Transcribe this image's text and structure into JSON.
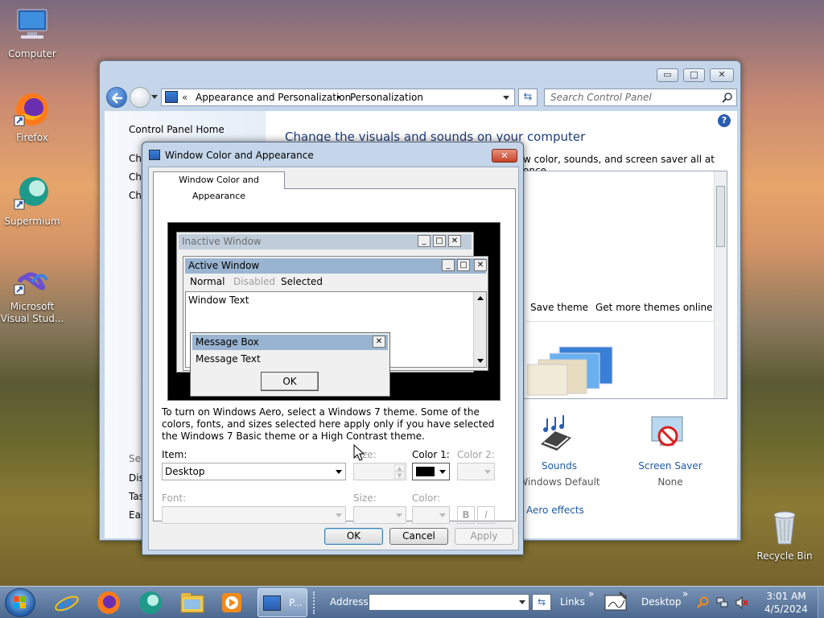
{
  "desktop": {
    "icons": [
      {
        "label": "Computer"
      },
      {
        "label": "Firefox"
      },
      {
        "label": "Supermium"
      },
      {
        "label": "Microsoft Visual Stud..."
      },
      {
        "label": "Recycle Bin"
      }
    ]
  },
  "control_panel": {
    "breadcrumb_prefix": "«",
    "breadcrumb_1": "Appearance and Personalization",
    "breadcrumb_sep": "▸",
    "breadcrumb_2": "Personalization",
    "search_placeholder": "Search Control Panel",
    "left_home": "Control Panel Home",
    "left_links": [
      "Ch",
      "Ch",
      "Ch"
    ],
    "see_also": "See",
    "see_also_links": [
      "Dis",
      "Tas",
      "Eas"
    ],
    "heading": "Change the visuals and sounds on your computer",
    "subheading": "w color, sounds, and screen saver all at once.",
    "save_theme": "Save theme",
    "get_more_themes": "Get more themes online",
    "sounds_label": "Sounds",
    "sounds_value": "Windows Default",
    "screensaver_label": "Screen Saver",
    "screensaver_value": "None",
    "aero_effects": "Aero effects"
  },
  "dialog": {
    "title": "Window Color and Appearance",
    "tab": "Window Color and Appearance",
    "preview": {
      "inactive_title": "Inactive Window",
      "active_title": "Active Window",
      "menu_normal": "Normal",
      "menu_disabled": "Disabled",
      "menu_selected": "Selected",
      "window_text": "Window Text",
      "msgbox_title": "Message Box",
      "msgbox_text": "Message Text",
      "msgbox_ok": "OK"
    },
    "info_text": "To turn on Windows Aero, select a Windows 7 theme.  Some of the colors, fonts, and sizes selected here apply only if you have selected the Windows 7 Basic theme or a High Contrast theme.",
    "item_label": "Item:",
    "item_value": "Desktop",
    "size_label": "Size:",
    "color1_label": "Color 1:",
    "color1_value": "#000000",
    "color2_label": "Color 2:",
    "font_label": "Font:",
    "font_size_label": "Size:",
    "font_color_label": "Color:",
    "bold": "B",
    "italic": "I",
    "ok": "OK",
    "cancel": "Cancel",
    "apply": "Apply"
  },
  "taskbar": {
    "active_task": "P...",
    "address_label": "Address",
    "links_label": "Links",
    "desktop_label": "Desktop",
    "time": "3:01 AM",
    "date": "4/5/2024"
  }
}
